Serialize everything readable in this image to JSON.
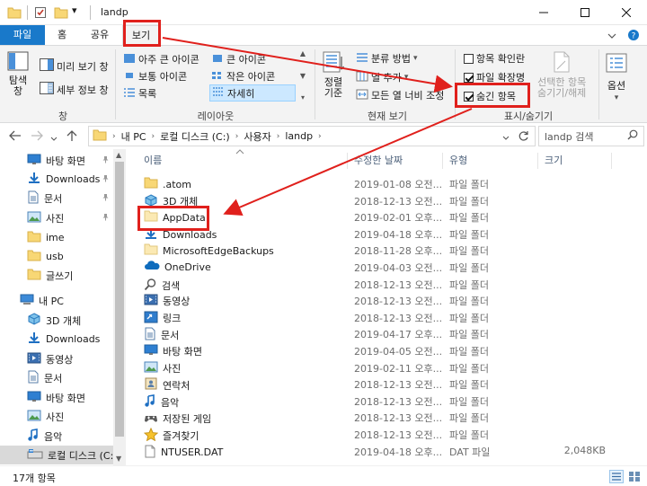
{
  "window": {
    "title": "landp",
    "quick_access": {
      "dropdown_glyph": "▾"
    }
  },
  "tabs": {
    "file": "파일",
    "home": "홈",
    "share": "공유",
    "view": "보기"
  },
  "ribbon": {
    "panes": {
      "label": "창",
      "nav_pane": "탐색\n창",
      "preview_pane": "미리 보기 창",
      "details_pane": "세부 정보 창"
    },
    "layout": {
      "label": "레이아웃",
      "items": [
        "아주 큰 아이콘",
        "큰 아이콘",
        "보통 아이콘",
        "작은 아이콘",
        "목록",
        "자세히"
      ],
      "selected": "자세히"
    },
    "current_view": {
      "label": "현재 보기",
      "sort_by": "정렬\n기준",
      "group_by": "분류 방법",
      "add_columns": "열 추가",
      "size_all_columns": "모든 열 너비 조정"
    },
    "show_hide": {
      "label": "표시/숨기기",
      "item_checkboxes": {
        "label": "항목 확인란",
        "checked": false
      },
      "file_extensions": {
        "label": "파일 확장명",
        "checked": true
      },
      "hidden_items": {
        "label": "숨긴 항목",
        "checked": true
      },
      "hide_selected": "선택한 항목\n숨기기/해제"
    },
    "options": {
      "label": "옵션"
    }
  },
  "address": {
    "segments": [
      "내 PC",
      "로컬 디스크 (C:)",
      "사용자",
      "landp"
    ],
    "search_placeholder": "landp 검색"
  },
  "nav_pane": {
    "items": [
      {
        "label": "바탕 화면",
        "icon": "desktop-icon",
        "pinned": true
      },
      {
        "label": "Downloads",
        "icon": "download-icon",
        "pinned": true
      },
      {
        "label": "문서",
        "icon": "document-icon",
        "pinned": true
      },
      {
        "label": "사진",
        "icon": "pictures-icon",
        "pinned": true
      },
      {
        "label": "ime",
        "icon": "folder-icon",
        "pinned": false
      },
      {
        "label": "usb",
        "icon": "folder-icon",
        "pinned": false
      },
      {
        "label": "글쓰기",
        "icon": "folder-icon",
        "pinned": false
      },
      {
        "label": "내 PC",
        "icon": "computer-icon",
        "pinned": false
      },
      {
        "label": "3D 개체",
        "icon": "3d-objects-icon",
        "pinned": false
      },
      {
        "label": "Downloads",
        "icon": "download-icon",
        "pinned": false
      },
      {
        "label": "동영상",
        "icon": "video-icon",
        "pinned": false
      },
      {
        "label": "문서",
        "icon": "document-icon",
        "pinned": false
      },
      {
        "label": "바탕 화면",
        "icon": "desktop-icon",
        "pinned": false
      },
      {
        "label": "사진",
        "icon": "pictures-icon",
        "pinned": false
      },
      {
        "label": "음악",
        "icon": "music-icon",
        "pinned": false
      },
      {
        "label": "로컬 디스크 (C:)",
        "icon": "drive-icon",
        "pinned": false,
        "selected": true
      }
    ]
  },
  "file_list": {
    "columns": {
      "name": "이름",
      "date": "수정한 날짜",
      "type": "유형",
      "size": "크기"
    },
    "rows": [
      {
        "name": ".atom",
        "date": "2019-01-08 오전...",
        "type": "파일 폴더",
        "size": "",
        "icon": "folder-icon"
      },
      {
        "name": "3D 개체",
        "date": "2018-12-13 오전...",
        "type": "파일 폴더",
        "size": "",
        "icon": "3d-objects-icon"
      },
      {
        "name": "AppData",
        "date": "2019-02-01 오후...",
        "type": "파일 폴더",
        "size": "",
        "icon": "folder-pale-icon"
      },
      {
        "name": "Downloads",
        "date": "2019-04-18 오후...",
        "type": "파일 폴더",
        "size": "",
        "icon": "download-icon"
      },
      {
        "name": "MicrosoftEdgeBackups",
        "date": "2018-11-28 오후...",
        "type": "파일 폴더",
        "size": "",
        "icon": "folder-pale-icon"
      },
      {
        "name": "OneDrive",
        "date": "2019-04-03 오전...",
        "type": "파일 폴더",
        "size": "",
        "icon": "onedrive-icon"
      },
      {
        "name": "검색",
        "date": "2018-12-13 오전...",
        "type": "파일 폴더",
        "size": "",
        "icon": "search-folder-icon"
      },
      {
        "name": "동영상",
        "date": "2018-12-13 오전...",
        "type": "파일 폴더",
        "size": "",
        "icon": "video-icon"
      },
      {
        "name": "링크",
        "date": "2018-12-13 오전...",
        "type": "파일 폴더",
        "size": "",
        "icon": "links-icon"
      },
      {
        "name": "문서",
        "date": "2019-04-17 오후...",
        "type": "파일 폴더",
        "size": "",
        "icon": "document-icon"
      },
      {
        "name": "바탕 화면",
        "date": "2019-04-05 오전...",
        "type": "파일 폴더",
        "size": "",
        "icon": "desktop-icon"
      },
      {
        "name": "사진",
        "date": "2019-02-11 오후...",
        "type": "파일 폴더",
        "size": "",
        "icon": "pictures-icon"
      },
      {
        "name": "연락처",
        "date": "2018-12-13 오전...",
        "type": "파일 폴더",
        "size": "",
        "icon": "contacts-icon"
      },
      {
        "name": "음악",
        "date": "2018-12-13 오전...",
        "type": "파일 폴더",
        "size": "",
        "icon": "music-icon"
      },
      {
        "name": "저장된 게임",
        "date": "2018-12-13 오전...",
        "type": "파일 폴더",
        "size": "",
        "icon": "saved-games-icon"
      },
      {
        "name": "즐겨찾기",
        "date": "2018-12-13 오전...",
        "type": "파일 폴더",
        "size": "",
        "icon": "favorites-icon"
      },
      {
        "name": "NTUSER.DAT",
        "date": "2019-04-18 오후...",
        "type": "DAT 파일",
        "size": "2,048KB",
        "icon": "file-icon"
      }
    ]
  },
  "status": {
    "item_count": "17개 항목"
  },
  "colors": {
    "accent": "#1979ca",
    "highlight_red": "#e0201c",
    "selection": "#cce8ff"
  }
}
